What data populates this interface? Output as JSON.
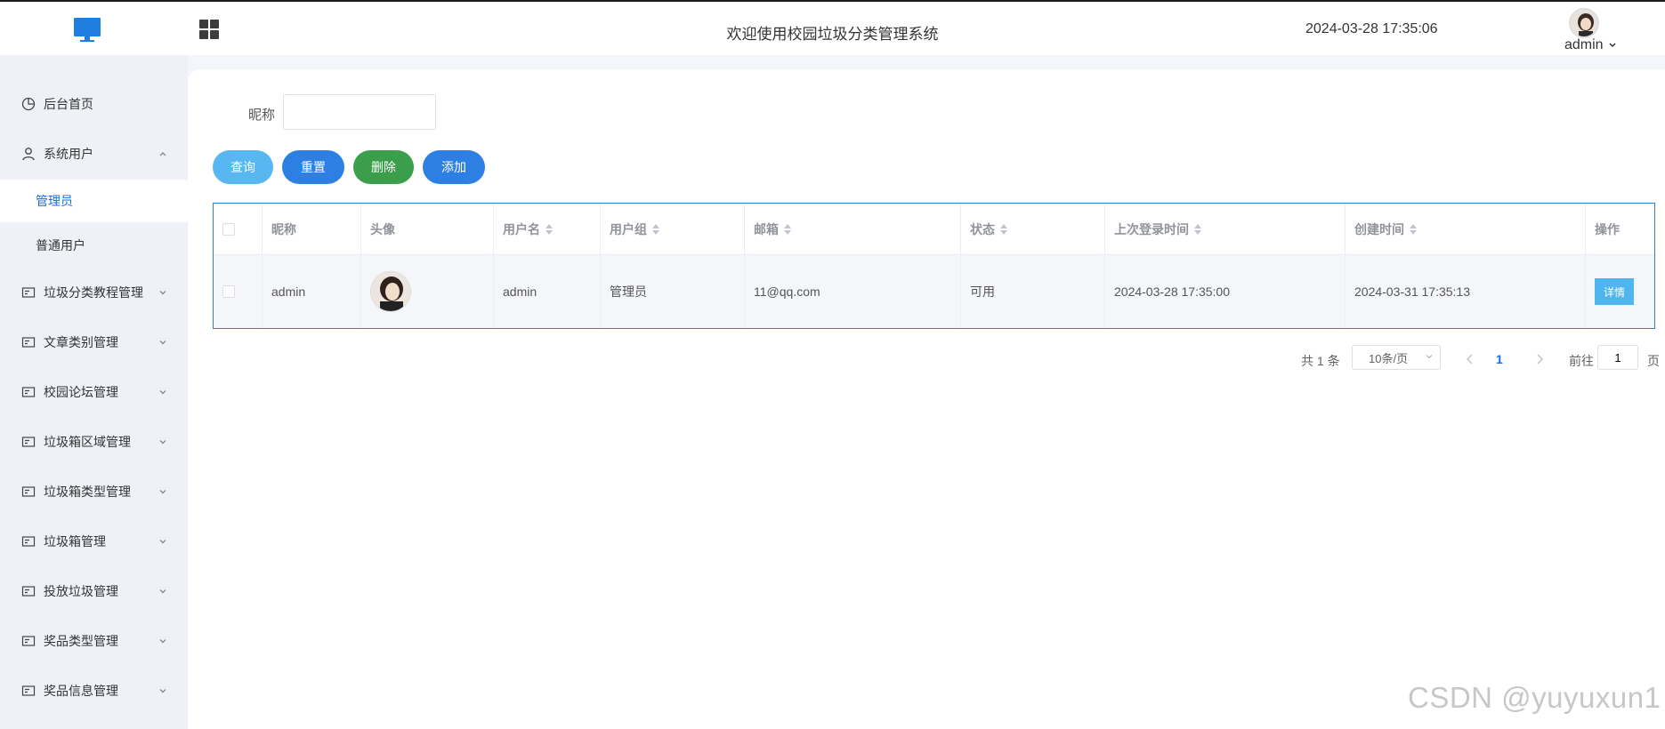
{
  "header": {
    "title": "欢迎使用校园垃圾分类管理系统",
    "datetime": "2024-03-28 17:35:06",
    "username": "admin"
  },
  "colors": {
    "primary": "#2e7fe3",
    "query": "#58b7f0",
    "delete": "#3a9e4a",
    "sidebar_bg": "#eef2f8"
  },
  "sidebar": {
    "home": "后台首页",
    "system_users": "系统用户",
    "sub_admin": "管理员",
    "sub_user": "普通用户",
    "items": [
      "垃圾分类教程管理",
      "文章类别管理",
      "校园论坛管理",
      "垃圾箱区域管理",
      "垃圾箱类型管理",
      "垃圾箱管理",
      "投放垃圾管理",
      "奖品类型管理",
      "奖品信息管理"
    ]
  },
  "search": {
    "label": "昵称",
    "value": ""
  },
  "buttons": {
    "query": "查询",
    "reset": "重置",
    "delete": "删除",
    "add": "添加"
  },
  "table": {
    "headers": {
      "nickname": "昵称",
      "avatar": "头像",
      "username": "用户名",
      "group": "用户组",
      "email": "邮箱",
      "status": "状态",
      "last_login": "上次登录时间",
      "created": "创建时间",
      "action": "操作"
    },
    "rows": [
      {
        "nickname": "admin",
        "username": "admin",
        "group": "管理员",
        "email": "11@qq.com",
        "status": "可用",
        "last_login": "2024-03-28 17:35:00",
        "created": "2024-03-31 17:35:13",
        "action": "详情"
      }
    ]
  },
  "pagination": {
    "total": "共 1 条",
    "page_size": "10条/页",
    "current": "1",
    "goto_label": "前往",
    "goto_value": "1",
    "page_suffix": "页"
  },
  "watermark": "CSDN @yuyuxun1"
}
